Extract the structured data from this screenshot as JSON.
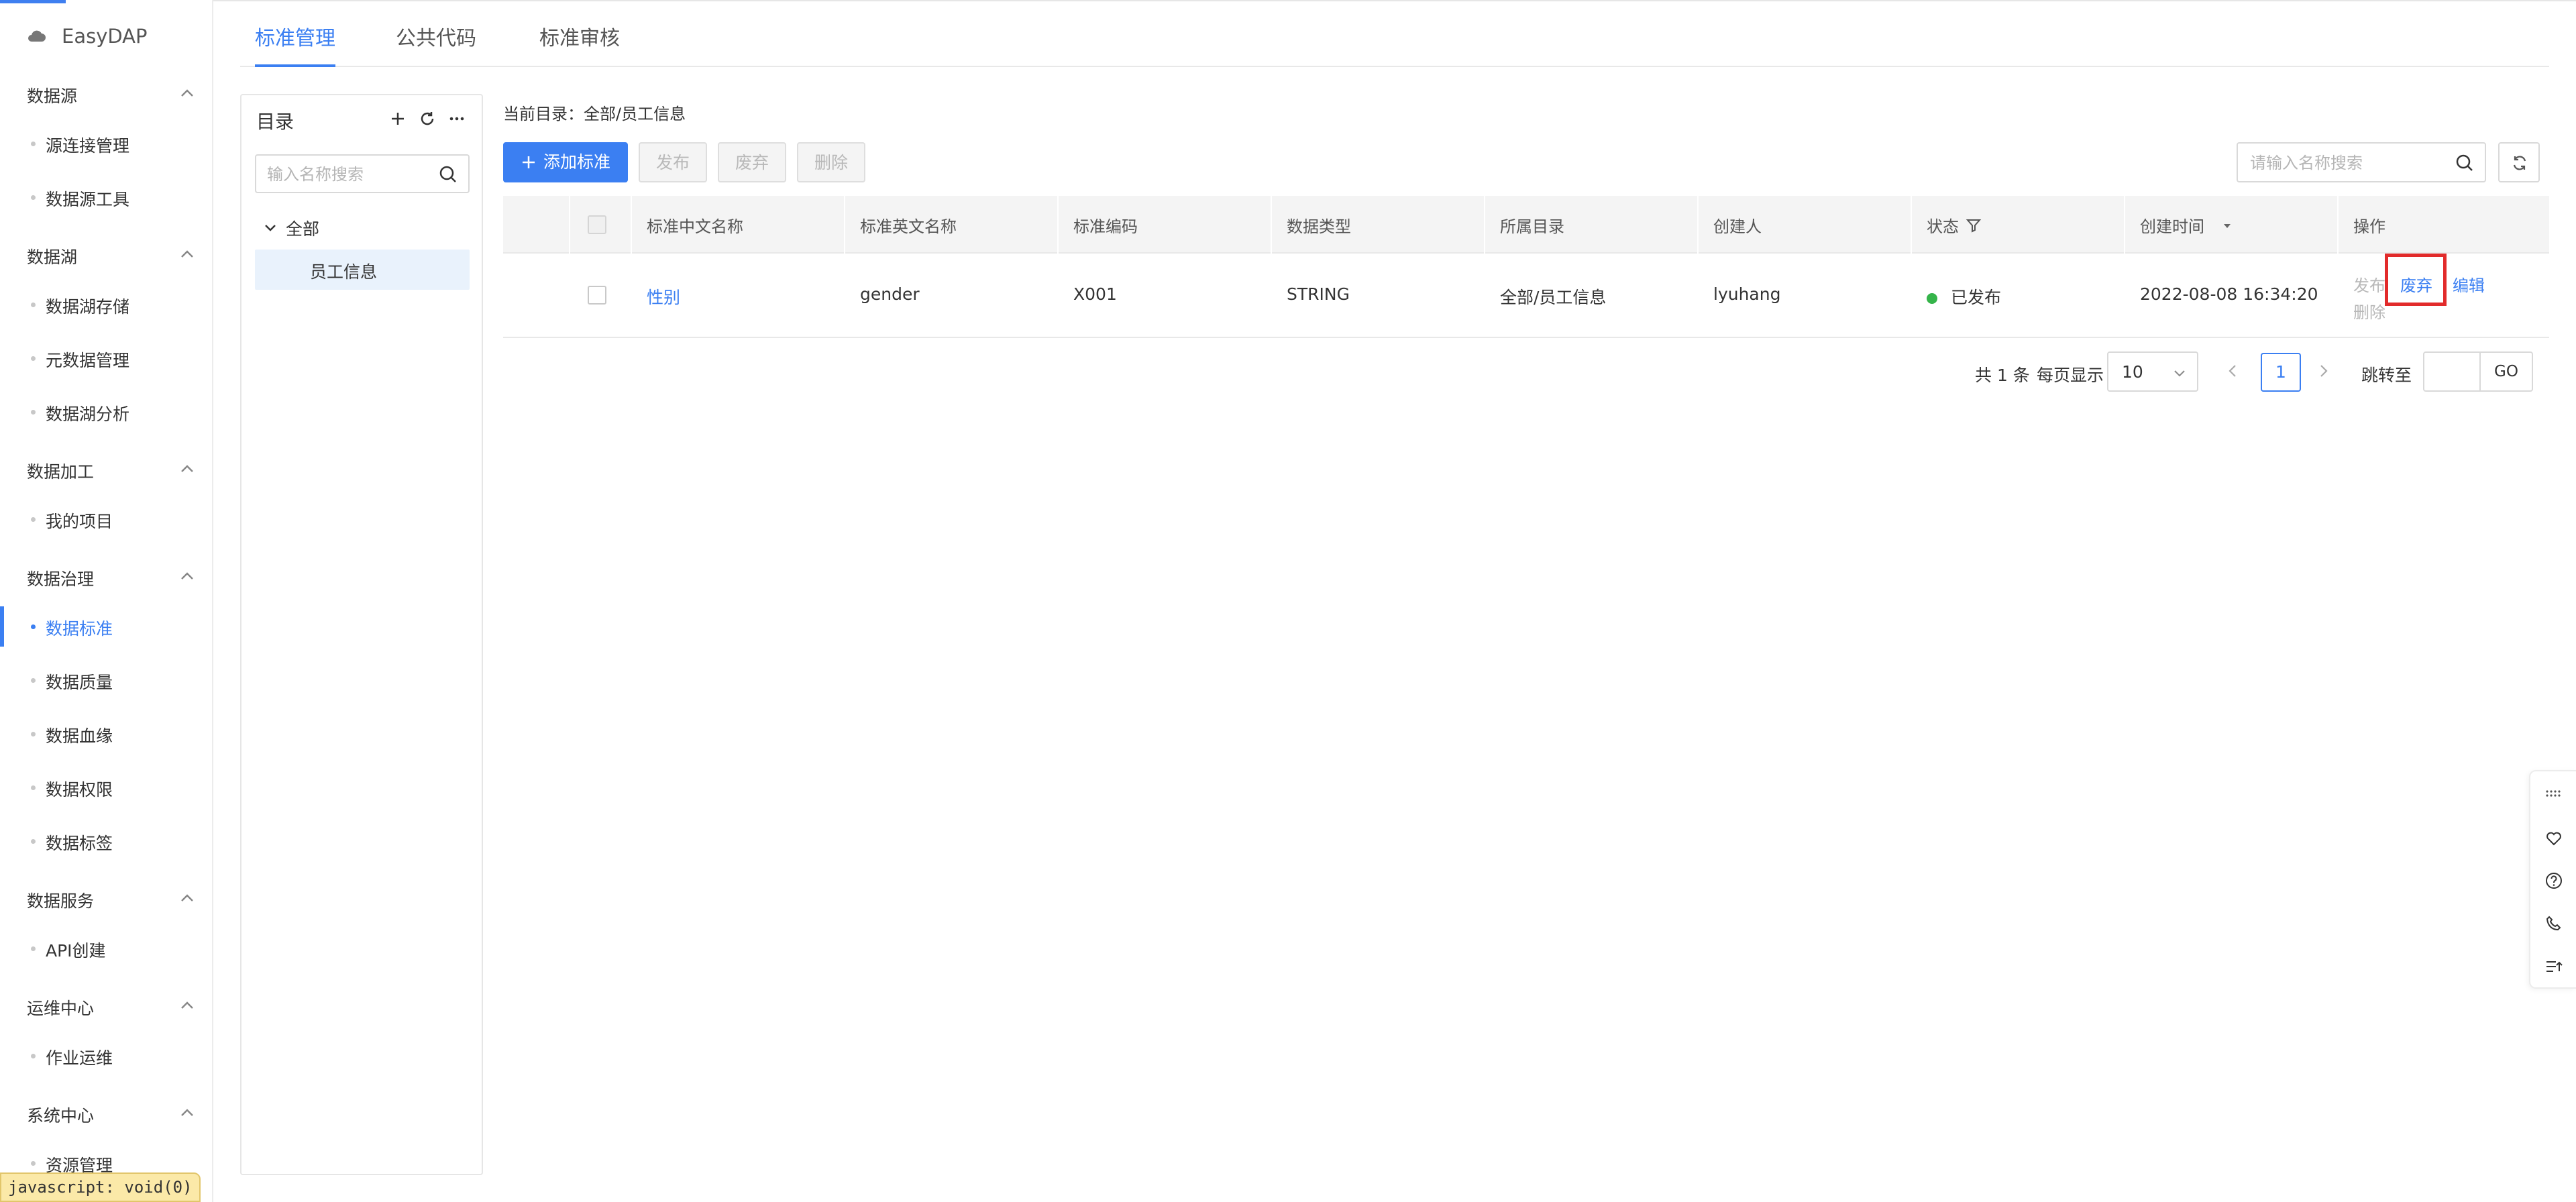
{
  "app": {
    "name": "EasyDAP"
  },
  "sidebar": {
    "groups": [
      {
        "label": "数据源",
        "items": [
          "源连接管理",
          "数据源工具"
        ]
      },
      {
        "label": "数据湖",
        "items": [
          "数据湖存储",
          "元数据管理",
          "数据湖分析"
        ]
      },
      {
        "label": "数据加工",
        "items": [
          "我的项目"
        ]
      },
      {
        "label": "数据治理",
        "items": [
          "数据标准",
          "数据质量",
          "数据血缘",
          "数据权限",
          "数据标签"
        ]
      },
      {
        "label": "数据服务",
        "items": [
          "API创建"
        ]
      },
      {
        "label": "运维中心",
        "items": [
          "作业运维"
        ]
      },
      {
        "label": "系统中心",
        "items": [
          "资源管理"
        ]
      }
    ],
    "active_item": "数据标准"
  },
  "tabs": [
    "标准管理",
    "公共代码",
    "标准审核"
  ],
  "active_tab": "标准管理",
  "directory": {
    "title": "目录",
    "search_placeholder": "输入名称搜索",
    "root": "全部",
    "selected": "员工信息"
  },
  "breadcrumb": "当前目录：全部/员工信息",
  "toolbar": {
    "add": "添加标准",
    "publish": "发布",
    "abandon": "废弃",
    "delete": "删除",
    "search_placeholder": "请输入名称搜索"
  },
  "table": {
    "columns": [
      "标准中文名称",
      "标准英文名称",
      "标准编码",
      "数据类型",
      "所属目录",
      "创建人",
      "状态",
      "创建时间",
      "操作"
    ],
    "rows": [
      {
        "cn_name": "性别",
        "en_name": "gender",
        "code": "X001",
        "data_type": "STRING",
        "directory": "全部/员工信息",
        "creator": "lyuhang",
        "status": "已发布",
        "created_at": "2022-08-08 16:34:20",
        "ops": {
          "publish": "发布",
          "abandon": "废弃",
          "edit": "编辑",
          "delete": "删除"
        }
      }
    ]
  },
  "pagination": {
    "total": "共 1 条",
    "per_page_label": "每页显示",
    "per_page": "10",
    "current_page": "1",
    "jump_label": "跳转至",
    "go": "GO"
  },
  "status_bar": "javascript: void(0)",
  "colors": {
    "accent": "#3b7ff2",
    "published": "#35b44a",
    "highlight": "#e22b2b"
  }
}
